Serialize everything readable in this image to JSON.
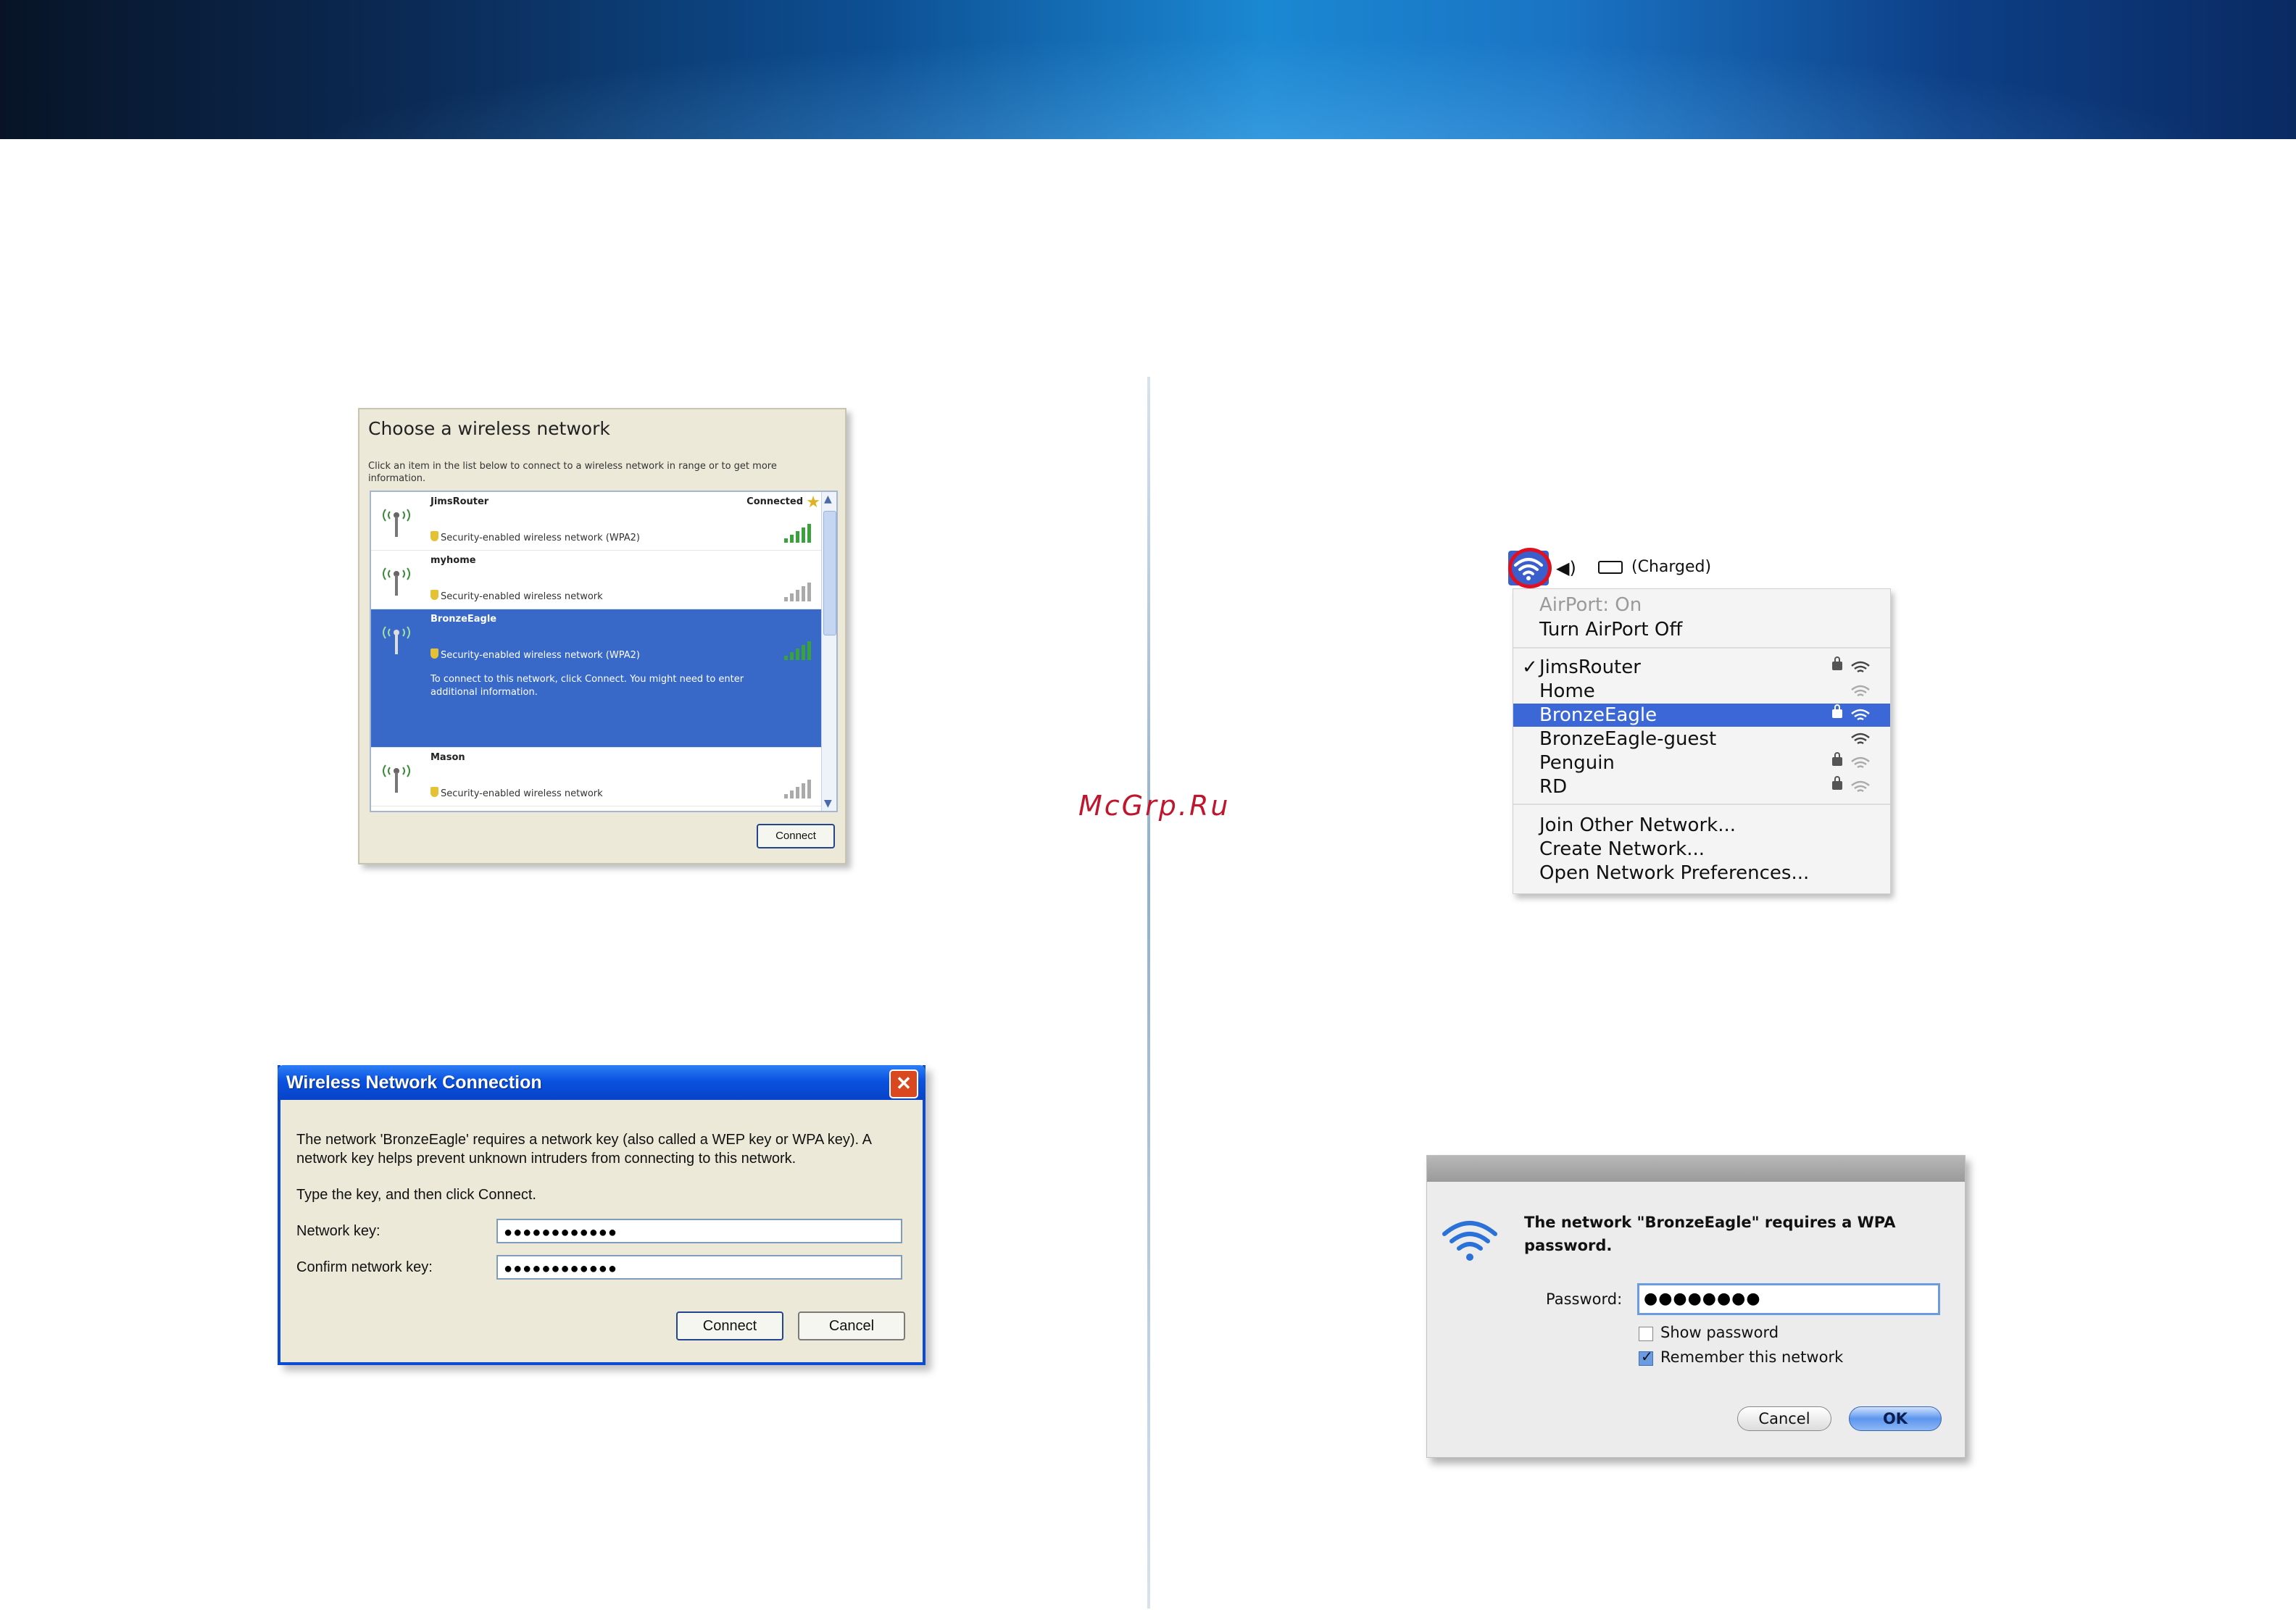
{
  "watermark": "McGrp.Ru",
  "xp_choose": {
    "title": "Choose a wireless network",
    "description": "Click an item in the list below to connect to a wireless network in range or to get more information.",
    "networks": [
      {
        "name": "JimsRouter",
        "status": "Connected",
        "security": "Security-enabled wireless network (WPA2)"
      },
      {
        "name": "myhome",
        "status": "",
        "security": "Security-enabled wireless network"
      },
      {
        "name": "BronzeEagle",
        "status": "",
        "security": "Security-enabled wireless network (WPA2)",
        "info": "To connect to this network, click Connect. You might need to enter additional information."
      },
      {
        "name": "Mason",
        "status": "",
        "security": "Security-enabled wireless network"
      }
    ],
    "connect_label": "Connect"
  },
  "xp_dialog": {
    "title": "Wireless Network Connection",
    "message": "The network 'BronzeEagle' requires a network key (also called a WEP key or WPA key). A network key helps prevent unknown intruders from connecting to this network.",
    "instruction": "Type the key, and then click Connect.",
    "network_key_label": "Network key:",
    "network_key_value": "●●●●●●●●●●●●",
    "confirm_key_label": "Confirm network key:",
    "confirm_key_value": "●●●●●●●●●●●●",
    "connect_label": "Connect",
    "cancel_label": "Cancel"
  },
  "mac_menu": {
    "battery_text": "(Charged)",
    "airport_status": "AirPort: On",
    "turn_off": "Turn AirPort Off",
    "networks": [
      {
        "name": "JimsRouter",
        "checked": "✓",
        "locked": true
      },
      {
        "name": "Home",
        "checked": "",
        "locked": false
      },
      {
        "name": "BronzeEagle",
        "checked": "",
        "locked": true
      },
      {
        "name": "BronzeEagle-guest",
        "checked": "",
        "locked": false
      },
      {
        "name": "Penguin",
        "checked": "",
        "locked": true
      },
      {
        "name": "RD",
        "checked": "",
        "locked": true
      }
    ],
    "join_other": "Join Other Network...",
    "create_network": "Create Network...",
    "open_prefs": "Open Network Preferences..."
  },
  "mac_dialog": {
    "message": "The network \"BronzeEagle\" requires a WPA password.",
    "password_label": "Password:",
    "password_value": "●●●●●●●●",
    "show_password": "Show password",
    "remember_network": "Remember this network",
    "cancel_label": "Cancel",
    "ok_label": "OK"
  }
}
